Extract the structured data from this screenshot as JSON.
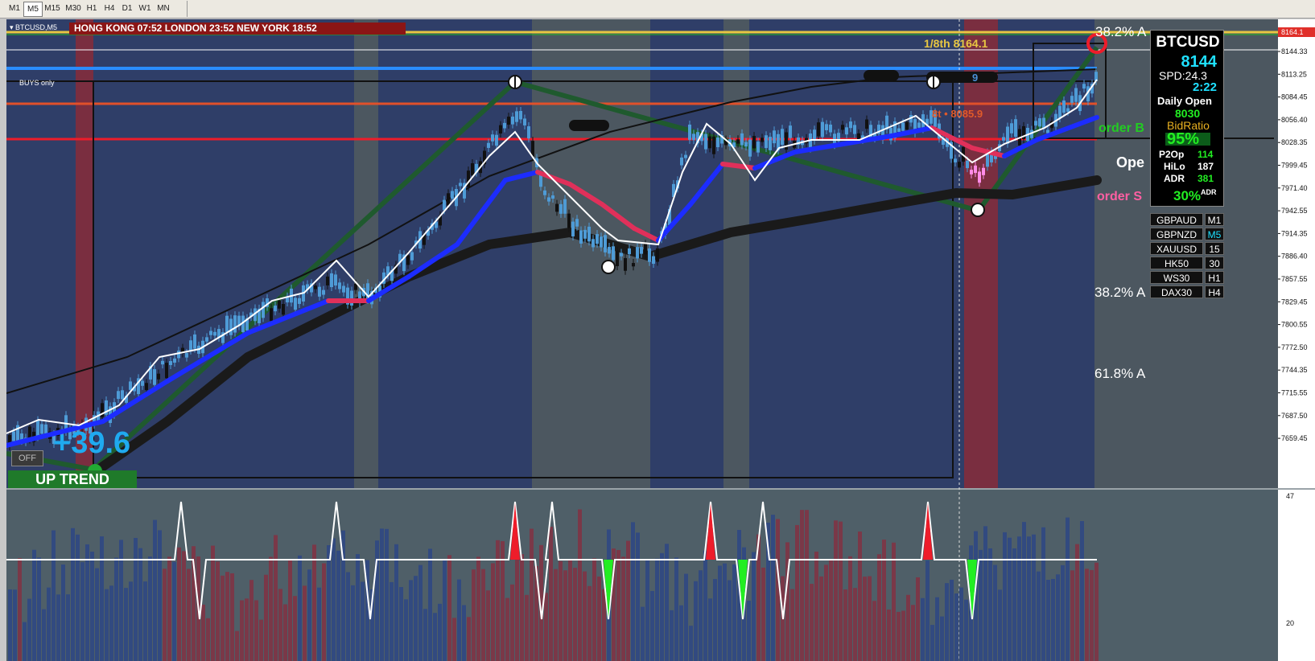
{
  "toolbar": {
    "timeframes": [
      {
        "label": "M1",
        "selected": false
      },
      {
        "label": "M5",
        "selected": true
      },
      {
        "label": "M15",
        "selected": false
      },
      {
        "label": "M30",
        "selected": false
      },
      {
        "label": "H1",
        "selected": false
      },
      {
        "label": "H4",
        "selected": false
      },
      {
        "label": "D1",
        "selected": false
      },
      {
        "label": "W1",
        "selected": false
      },
      {
        "label": "MN",
        "selected": false
      }
    ]
  },
  "chart": {
    "symbol_label": "BTCUSD,M5",
    "sessions": "HONG KONG 07:52   LONDON  23:52   NEW YORK  18:52",
    "buys_only": "BUYS only",
    "pips_change": "+39.6",
    "trend": "UP TREND",
    "off_button": "OFF",
    "level_eighth": "1/8th  8164.1",
    "level_target": "8t • 8085.9",
    "level_blue": "9",
    "fib_top": "38.2% A",
    "fib_mid": "38.2% A",
    "fib_low": "61.8% A",
    "order_buy": "order B",
    "order_sell": "order S",
    "open_label": "Ope",
    "colors": {
      "buy_green": "#22cc22",
      "sell_pink": "#ff5fa2",
      "ema_blue": "#1c2cff",
      "ema_red": "#e0305a",
      "trend_green": "#1f7a2a"
    }
  },
  "info_panel": {
    "symbol": "BTCUSD",
    "price": "8144",
    "spread": "SPD:24.3",
    "timer": "2:22",
    "daily_open_label": "Daily Open",
    "daily_open": "8030",
    "bid_ratio_label": "BidRatio",
    "bid_ratio": "95%",
    "p2op_label": "P2Op",
    "p2op": "114",
    "hilo_label": "HiLo",
    "hilo": "187",
    "adr_label": "ADR",
    "adr": "381",
    "adr_pct": "30%",
    "adr_small": "ADR"
  },
  "symbols": [
    {
      "name": "GBPAUD",
      "tf": "M1",
      "active": false
    },
    {
      "name": "GBPNZD",
      "tf": "M5",
      "active": true
    },
    {
      "name": "XAUUSD",
      "tf": "15",
      "active": false
    },
    {
      "name": "HK50",
      "tf": "30",
      "active": false
    },
    {
      "name": "WS30",
      "tf": "H1",
      "active": false
    },
    {
      "name": "DAX30",
      "tf": "H4",
      "active": false
    }
  ],
  "price_axis": {
    "labels": [
      "8164.1",
      "8144.33",
      "8113.25",
      "8084.45",
      "8056.40",
      "8028.35",
      "7999.45",
      "7971.40",
      "7942.55",
      "7914.35",
      "7886.40",
      "7857.55",
      "7829.45",
      "7800.55",
      "7772.50",
      "7744.35",
      "7715.55",
      "7687.50",
      "7659.45"
    ],
    "current": "8164.1"
  },
  "sub_axis": {
    "top": "47",
    "bottom": "20"
  }
}
